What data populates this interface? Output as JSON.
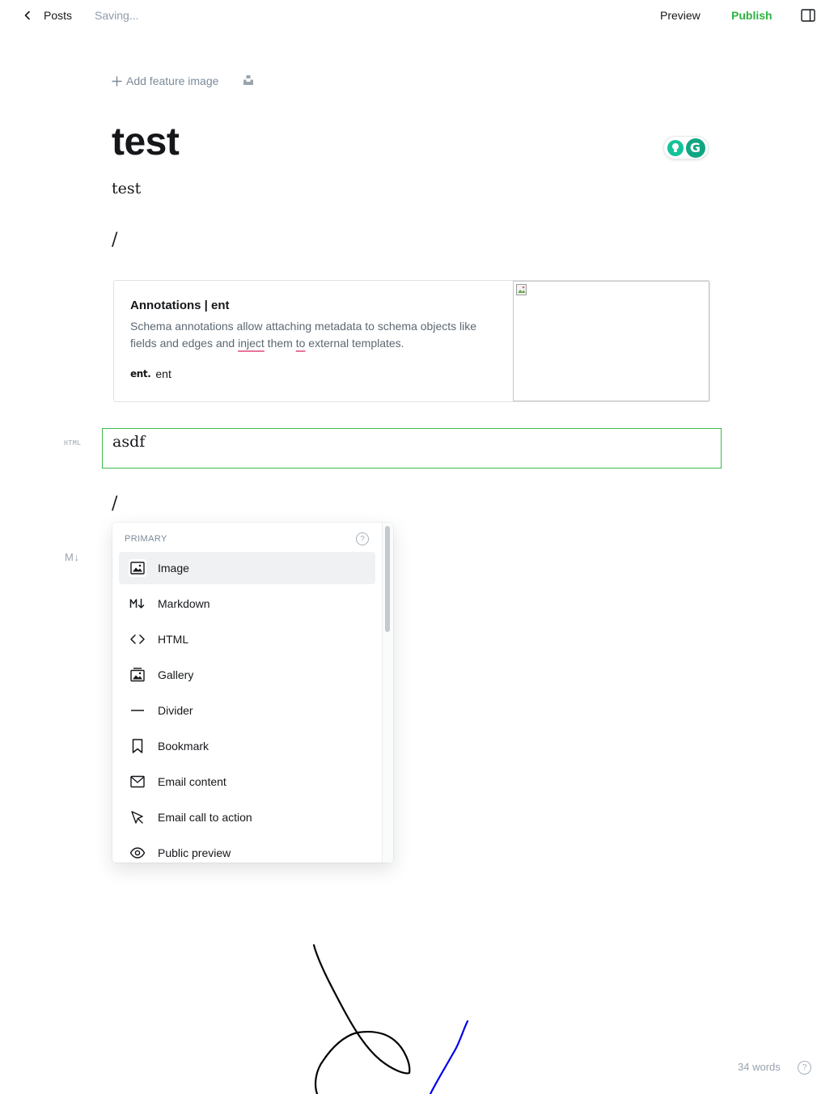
{
  "topbar": {
    "back_label": "Posts",
    "status": "Saving...",
    "preview_label": "Preview",
    "publish_label": "Publish"
  },
  "feature": {
    "add_label": "Add feature image"
  },
  "post": {
    "title": "test",
    "excerpt": "test",
    "slash_1": "/",
    "slash_2": "/"
  },
  "bookmark": {
    "title": "Annotations | ent",
    "description_before": "Schema annotations allow attaching metadata to schema objects like fields and edges and ",
    "description_spell_1": "inject",
    "description_middle": " them ",
    "description_spell_2": "to",
    "description_after": " external templates.",
    "icon_text": "ent.",
    "publisher": "ent"
  },
  "html_card": {
    "label": "HTML",
    "content": "asdf"
  },
  "markdown_label": "M↓",
  "card_menu": {
    "section": "PRIMARY",
    "help": "?",
    "items": [
      {
        "label": "Image",
        "icon": "image-icon"
      },
      {
        "label": "Markdown",
        "icon": "markdown-icon"
      },
      {
        "label": "HTML",
        "icon": "code-icon"
      },
      {
        "label": "Gallery",
        "icon": "gallery-icon"
      },
      {
        "label": "Divider",
        "icon": "divider-icon"
      },
      {
        "label": "Bookmark",
        "icon": "bookmark-icon"
      },
      {
        "label": "Email content",
        "icon": "mail-icon"
      },
      {
        "label": "Email call to action",
        "icon": "cursor-icon"
      },
      {
        "label": "Public preview",
        "icon": "eye-icon"
      }
    ]
  },
  "footer": {
    "word_count": "34 words",
    "help": "?"
  },
  "colors": {
    "publish_green": "#2fb343",
    "html_card_border": "#3eb94c",
    "spellcheck_underline": "#e8749a",
    "annotation_black": "#000000",
    "annotation_blue": "#0000ee"
  }
}
